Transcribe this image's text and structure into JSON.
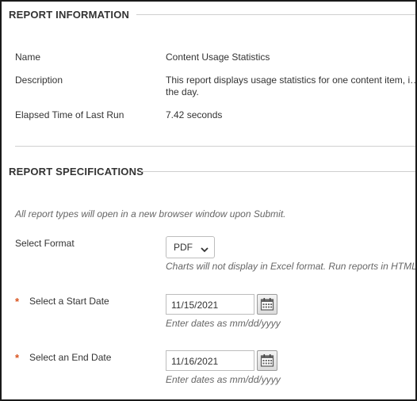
{
  "report_information": {
    "title": "REPORT INFORMATION",
    "rows": [
      {
        "label": "Name",
        "value": "Content Usage Statistics"
      },
      {
        "label": "Description",
        "value": "This report displays usage statistics for one content item, i… the day."
      },
      {
        "label": "Elapsed Time of Last Run",
        "value": "7.42 seconds"
      }
    ]
  },
  "report_specifications": {
    "title": "REPORT SPECIFICATIONS",
    "note": "All report types will open in a new browser window upon Submit.",
    "format": {
      "label": "Select Format",
      "selected": "PDF",
      "hint": "Charts will not display in Excel format. Run reports in HTML o"
    },
    "start_date": {
      "required_mark": "*",
      "label": "Select a Start Date",
      "value": "11/15/2021",
      "hint": "Enter dates as mm/dd/yyyy"
    },
    "end_date": {
      "required_mark": "*",
      "label": "Select an End Date",
      "value": "11/16/2021",
      "hint": "Enter dates as mm/dd/yyyy"
    }
  },
  "colors": {
    "required_star": "#d9531e",
    "text": "#333333",
    "hint_text": "#666666",
    "divider": "#cfcfcf"
  }
}
